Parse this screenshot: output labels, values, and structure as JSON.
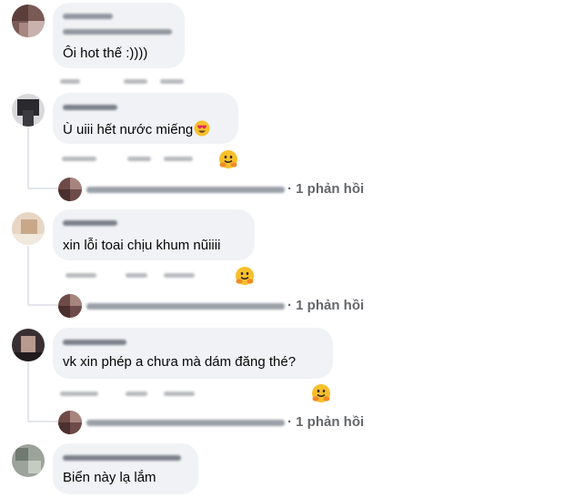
{
  "comments": [
    {
      "text": "Ôi hot thế :))))"
    },
    {
      "text": "Ù uiii hết nước miếng",
      "emoji": "heart-eyes-icon"
    },
    {
      "text": "xin lỗi toai chịu khum nũiiii"
    },
    {
      "text": "vk xin phép a chưa mà dám đăng thé?"
    },
    {
      "text": "Biển này lạ lắm"
    }
  ],
  "replies": [
    {
      "separator": "·",
      "label": "1 phản hồi"
    },
    {
      "separator": "·",
      "label": "1 phản hồi"
    },
    {
      "separator": "·",
      "label": "1 phản hồi"
    }
  ],
  "reaction_icon": "hugging-face-icon",
  "colors": {
    "bubble": "#f0f2f5",
    "thread_line": "#e4e6eb",
    "meta_text": "#65676b"
  }
}
